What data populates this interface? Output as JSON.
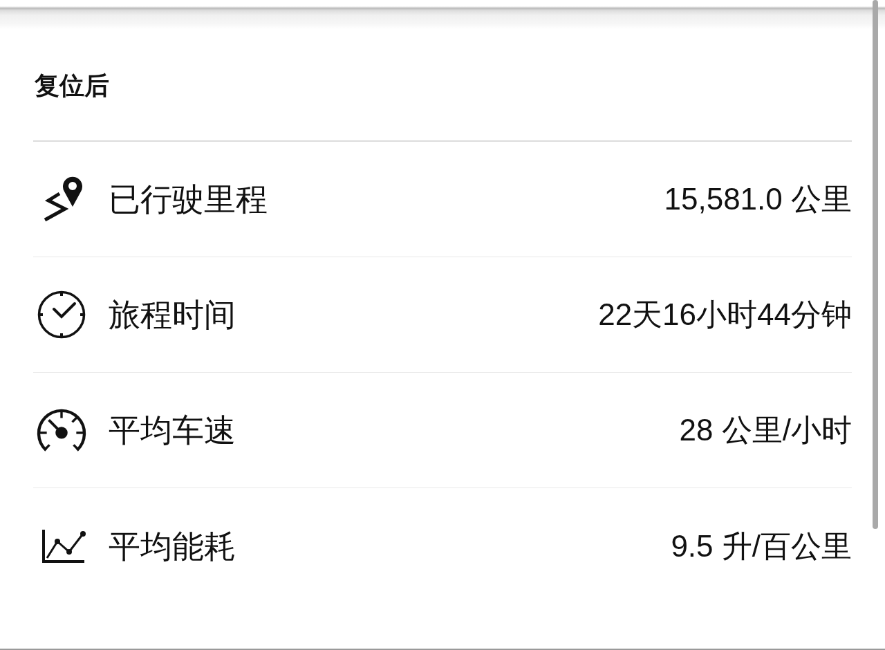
{
  "section_title": "复位后",
  "stats": [
    {
      "kind": "distance",
      "label": "已行驶里程",
      "value": "15,581.0 公里"
    },
    {
      "kind": "duration",
      "label": "旅程时间",
      "value": "22天16小时44分钟"
    },
    {
      "kind": "speed",
      "label": "平均车速",
      "value": "28 公里/小时"
    },
    {
      "kind": "consumption",
      "label": "平均能耗",
      "value": "9.5 升/百公里"
    }
  ]
}
